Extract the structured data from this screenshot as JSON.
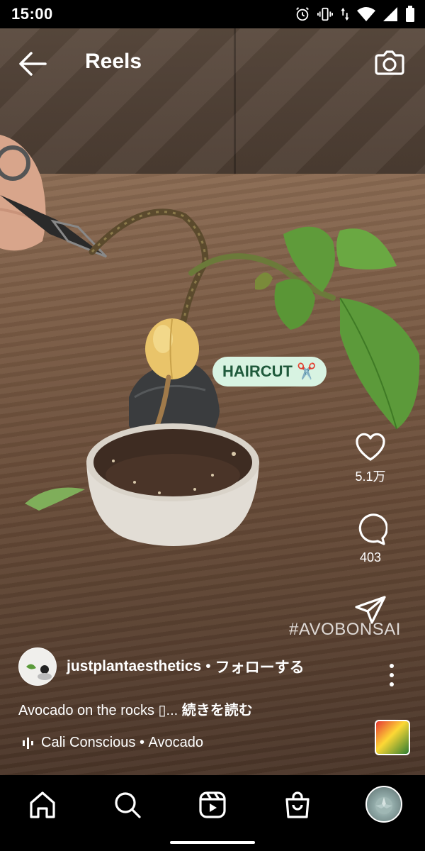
{
  "status_bar": {
    "time": "15:00"
  },
  "header": {
    "title": "Reels"
  },
  "sticker": {
    "text": "HAIRCUT ✂️"
  },
  "actions": {
    "likes": "5.1万",
    "comments": "403"
  },
  "hashtag_overlay": "#AVOBONSAI",
  "author": {
    "username": "justplantaesthetics",
    "separator": "•",
    "follow_label": "フォローする"
  },
  "caption": {
    "text": "Avocado on the rocks ",
    "glyph": "▯",
    "ellipsis": "... ",
    "more_label": "続きを読む"
  },
  "music": {
    "artist": "Cali Conscious",
    "separator": " • ",
    "track": "Avocado"
  },
  "icons": {
    "back": "arrow-left-icon",
    "camera": "camera-icon",
    "like": "heart-icon",
    "comment": "comment-bubble-icon",
    "share": "paper-plane-icon",
    "more": "vertical-dots-icon",
    "home": "home-icon",
    "search": "search-icon",
    "reels": "reels-icon",
    "shop": "shop-bag-icon"
  }
}
